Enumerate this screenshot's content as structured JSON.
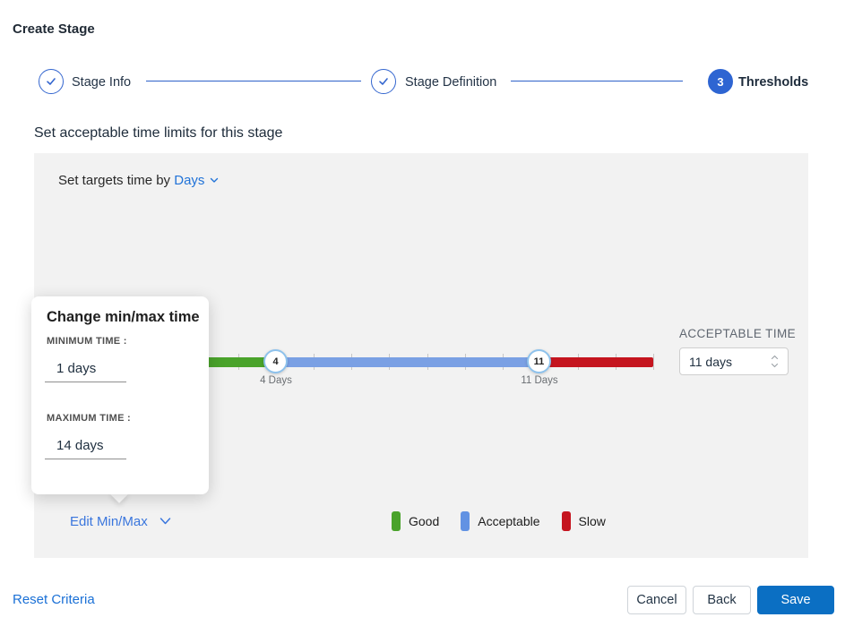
{
  "page": {
    "title": "Create Stage"
  },
  "stepper": {
    "steps": [
      {
        "label": "Stage Info",
        "state": "complete"
      },
      {
        "label": "Stage Definition",
        "state": "complete"
      },
      {
        "label": "Thresholds",
        "state": "active",
        "number": "3"
      }
    ]
  },
  "section": {
    "heading": "Set acceptable time limits for this stage"
  },
  "panel": {
    "target_prefix": "Set targets time by",
    "target_unit": "Days",
    "acceptable_time": {
      "label": "ACCEPTABLE TIME",
      "value": "11 days"
    },
    "edit_minmax_label": "Edit Min/Max"
  },
  "slider": {
    "min_day": 1,
    "max_day": 14,
    "handles": [
      {
        "value": "4",
        "label": "4 Days"
      },
      {
        "value": "11",
        "label": "11 Days"
      }
    ],
    "segments": [
      {
        "name": "good",
        "from": 1,
        "to": 4,
        "color": "#4aa32b"
      },
      {
        "name": "acceptable",
        "from": 4,
        "to": 11,
        "color": "#7aa0e4"
      },
      {
        "name": "slow",
        "from": 11,
        "to": 14,
        "color": "#c5151f"
      }
    ]
  },
  "legend": [
    {
      "label": "Good",
      "color": "#4aa32b"
    },
    {
      "label": "Acceptable",
      "color": "#6292e3"
    },
    {
      "label": "Slow",
      "color": "#c5151f"
    }
  ],
  "popover": {
    "title": "Change min/max time",
    "min_label": "MINIMUM TIME :",
    "min_value": "1 days",
    "max_label": "MAXIMUM TIME :",
    "max_value": "14 days"
  },
  "footer": {
    "reset_label": "Reset Criteria",
    "cancel_label": "Cancel",
    "back_label": "Back",
    "save_label": "Save"
  },
  "colors": {
    "accent_blue": "#2173d8",
    "primary_button": "#0b6fc3",
    "stepper_blue": "#3466cf",
    "panel_bg": "#f2f2f2"
  }
}
